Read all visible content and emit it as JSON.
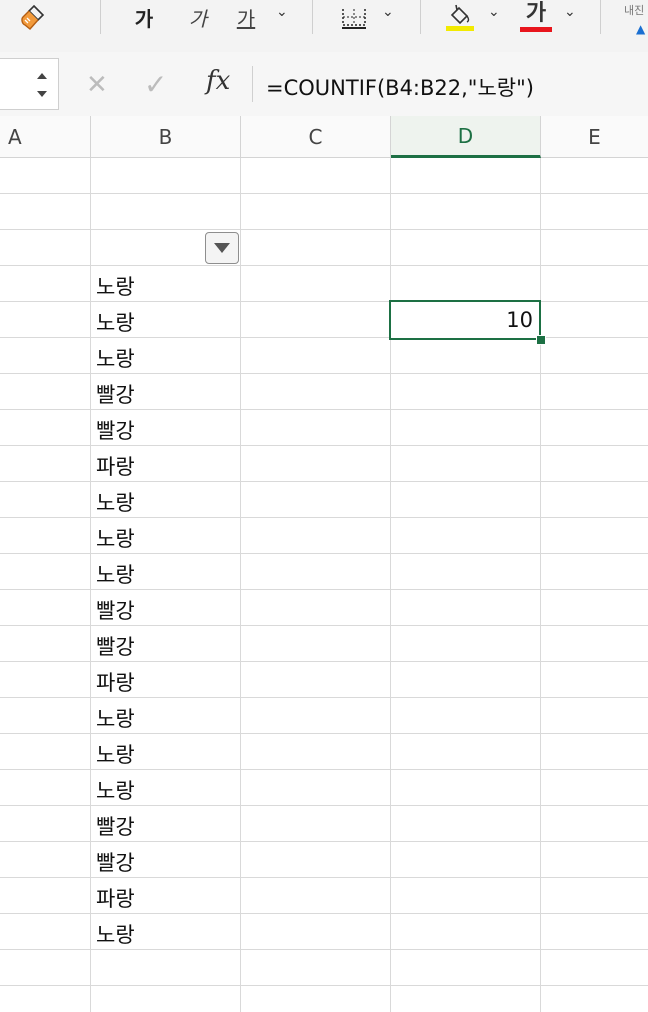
{
  "toolbar": {
    "bold_glyph": "가",
    "italic_glyph": "가",
    "underline_glyph": "가",
    "font_color_glyph": "가",
    "cut_off_label": "내진",
    "colors": {
      "fill": "#f2ea00",
      "font": "#e8151c",
      "accent": "#1d7044"
    }
  },
  "formula_bar": {
    "fx_label": "fx",
    "formula": "=COUNTIF(B4:B22,\"노랑\")"
  },
  "columns": [
    "A",
    "B",
    "C",
    "D",
    "E"
  ],
  "active_column": "D",
  "cells": {
    "b_values": [
      "노랑",
      "노랑",
      "노랑",
      "빨강",
      "빨강",
      "파랑",
      "노랑",
      "노랑",
      "노랑",
      "빨강",
      "빨강",
      "파랑",
      "노랑",
      "노랑",
      "노랑",
      "빨강",
      "빨강",
      "파랑",
      "노랑"
    ],
    "d5": "10"
  }
}
